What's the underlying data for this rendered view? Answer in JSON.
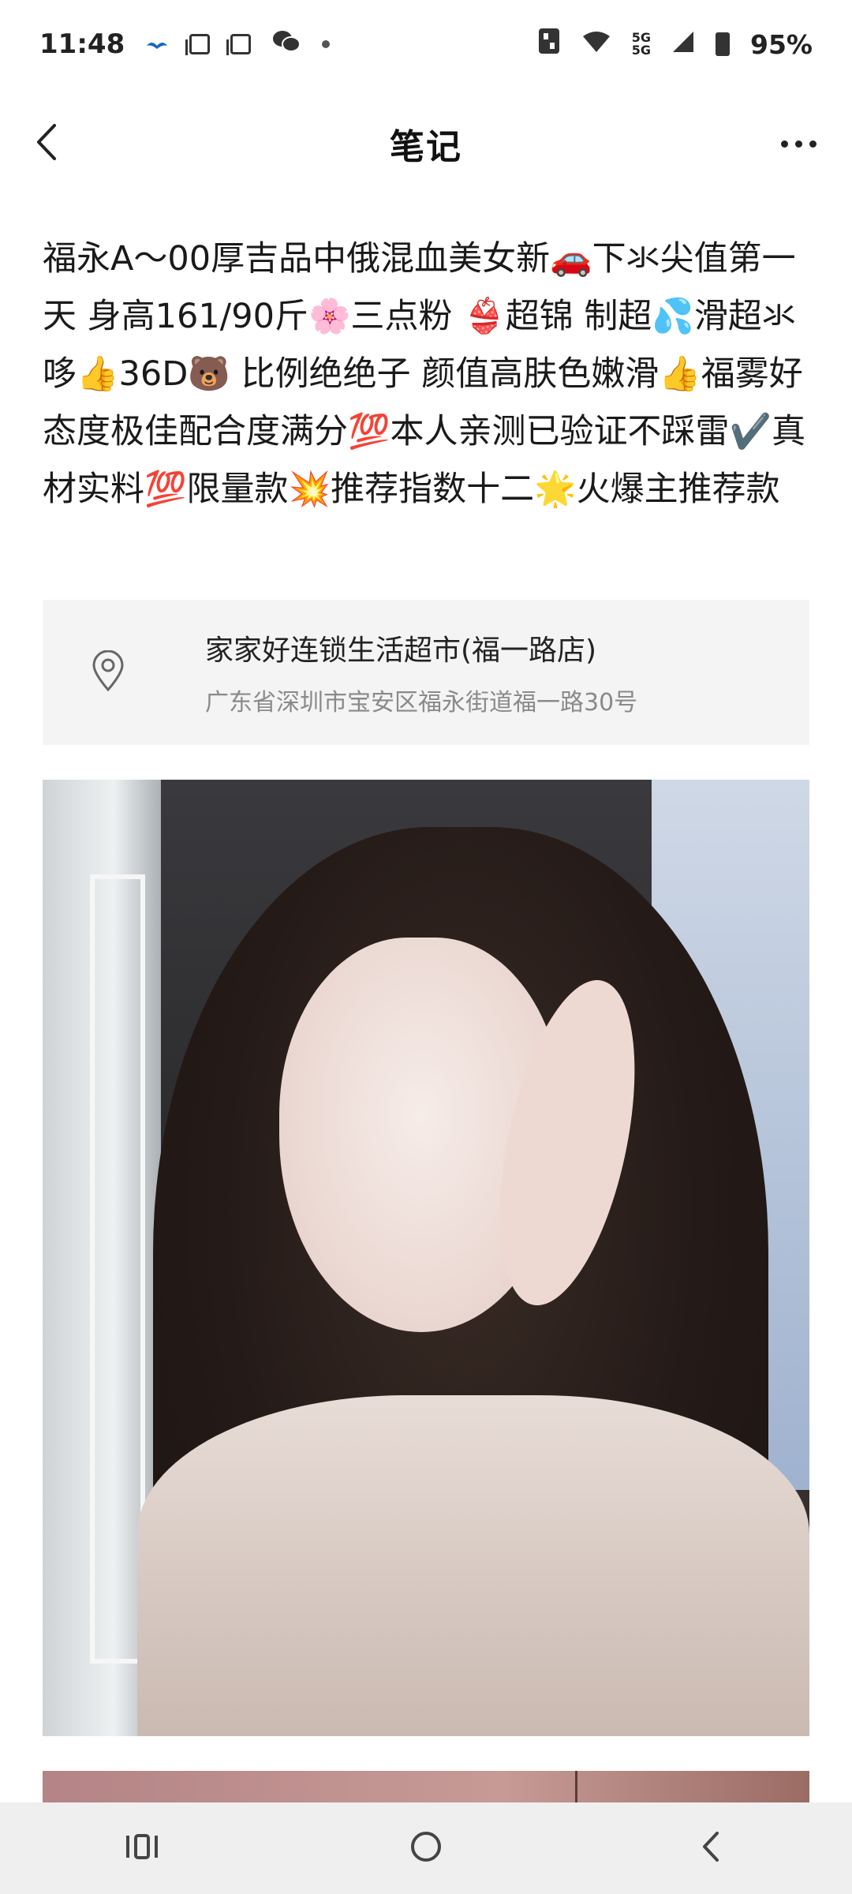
{
  "status_bar": {
    "time": "11:48",
    "network": "5G",
    "battery": "95%"
  },
  "header": {
    "title": "笔记",
    "back_icon": "chevron-left-icon",
    "more_icon": "more-horizontal-icon"
  },
  "post": {
    "text": "福永A～00厚吉品中俄混血美女新🚗下氺尖值第一天 身高161/90斤🌸三点粉 👙超锦 制超💦滑超氺哆👍36D🐻 比例绝绝子 颜值高肤色嫩滑👍福雾好态度极佳配合度满分💯本人亲测已验证不踩雷✔️真材实料💯限量款💥推荐指数十二🌟火爆主推荐款"
  },
  "location": {
    "icon": "location-pin-icon",
    "name": "家家好连锁生活超市(福一路店)",
    "address": "广东省深圳市宝安区福永街道福一路30号"
  },
  "nav": {
    "recents_icon": "recents-icon",
    "home_icon": "home-circle-icon",
    "back_icon": "back-arrow-icon"
  },
  "colors": {
    "location_bg": "#f4f4f4",
    "nav_bg": "#efefef",
    "secondary_text": "#8a8a8a"
  }
}
